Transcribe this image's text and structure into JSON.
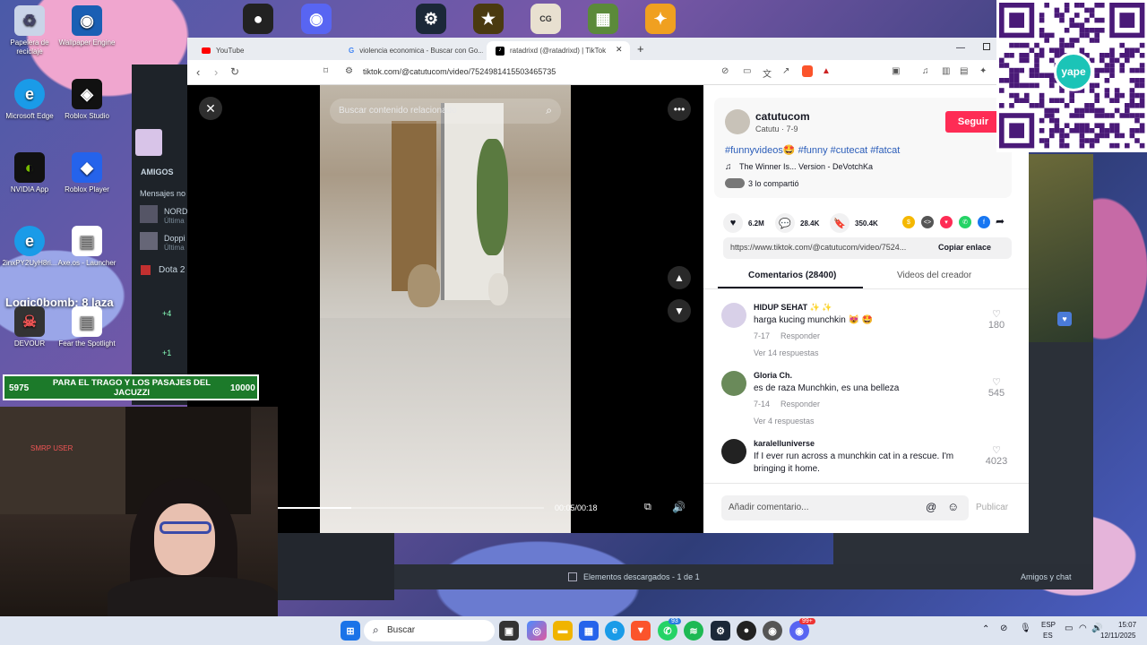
{
  "desktop": {
    "icons": [
      {
        "label": "Papelera de reciclaje",
        "icon": "recycle-bin-icon"
      },
      {
        "label": "Wallpaper Engine",
        "icon": "wallpaper-engine-icon"
      },
      {
        "label": "Microsoft Edge",
        "icon": "edge-icon"
      },
      {
        "label": "Roblox Studio",
        "icon": "roblox-studio-icon"
      },
      {
        "label": "NVIDIA App",
        "icon": "nvidia-icon"
      },
      {
        "label": "Roblox Player",
        "icon": "roblox-icon"
      },
      {
        "label": "2inxPY2UyH8ri...",
        "icon": "edge-icon"
      },
      {
        "label": "Axe.os - Launcher",
        "icon": "file-icon"
      },
      {
        "label": "DEVOUR",
        "icon": "devour-icon"
      },
      {
        "label": "Fear the Spotlight",
        "icon": "game-icon"
      }
    ],
    "overlay_text": "Logic0bomb: 8 laza"
  },
  "steam": {
    "section_friends": "AMIGOS",
    "messages": "Mensajes no",
    "friend1": "NORDI",
    "friend1_status": "Última",
    "friend2": "Doppi",
    "friend2_status": "Última",
    "group": "Dota 2",
    "badge1": "+4",
    "badge2": "+1",
    "downloads": "Elementos descargados - 1 de 1",
    "friends_chat": "Amigos y chat"
  },
  "browser": {
    "tabs": [
      {
        "label": "YouTube"
      },
      {
        "label": "violencia economica - Buscar con Go..."
      },
      {
        "label": "ratadrixd (@ratadrixd) | TikTok"
      }
    ],
    "new_tab": "+",
    "url": "tiktok.com/@catutucom/video/7524981415503465735"
  },
  "video": {
    "search_placeholder": "Buscar contenido relacionado",
    "time": "00:05/00:18",
    "progress": 0.28
  },
  "post": {
    "username": "catutucom",
    "display": "Catutu · 7-9",
    "follow": "Seguir",
    "hashtags": "#funnyvideos🤩 #funny #cutecat #fatcat",
    "music": "The Winner Is... Version - DeVotchKa",
    "shared": "3 lo compartió",
    "likes": "6.2M",
    "comments": "28.4K",
    "saves": "350.4K",
    "link": "https://www.tiktok.com/@catutucom/video/7524...",
    "copy_link": "Copiar enlace",
    "tab_comments": "Comentarios (28400)",
    "tab_creator": "Videos del creador"
  },
  "comments": [
    {
      "user": "HIDUP SEHAT ✨ ✨",
      "text": "harga kucing munchkin 😻 🤩",
      "date": "7-17",
      "reply": "Responder",
      "replies": "Ver 14 respuestas",
      "likes": "180"
    },
    {
      "user": "Gloria Ch.",
      "text": "es de raza Munchkin, es una belleza",
      "date": "7-14",
      "reply": "Responder",
      "replies": "Ver 4 respuestas",
      "likes": "545"
    },
    {
      "user": "karalelluniverse",
      "text": "If I ever run across a munchkin cat in a rescue. I'm bringing it home.",
      "date": "",
      "reply": "",
      "replies": "",
      "likes": "4023"
    }
  ],
  "composer": {
    "placeholder": "Añadir comentario...",
    "publish": "Publicar"
  },
  "overlay": {
    "qr_brand": "yape",
    "banner_left": "5975",
    "banner_text": "PARA EL TRAGO Y LOS PASAJES DEL JACUZZI",
    "banner_right": "10000",
    "webcam_sign": "SMRP USER"
  },
  "taskbar": {
    "search": "Buscar",
    "lang": "ESP",
    "lang_sub": "ES",
    "time": "15:07",
    "date": "12/11/2025",
    "badge1": "93",
    "badge2": "99+"
  },
  "colors": {
    "tiktok_red": "#fe2c55",
    "hashtag": "#2b5db9",
    "steam_bg": "#1e2329"
  }
}
